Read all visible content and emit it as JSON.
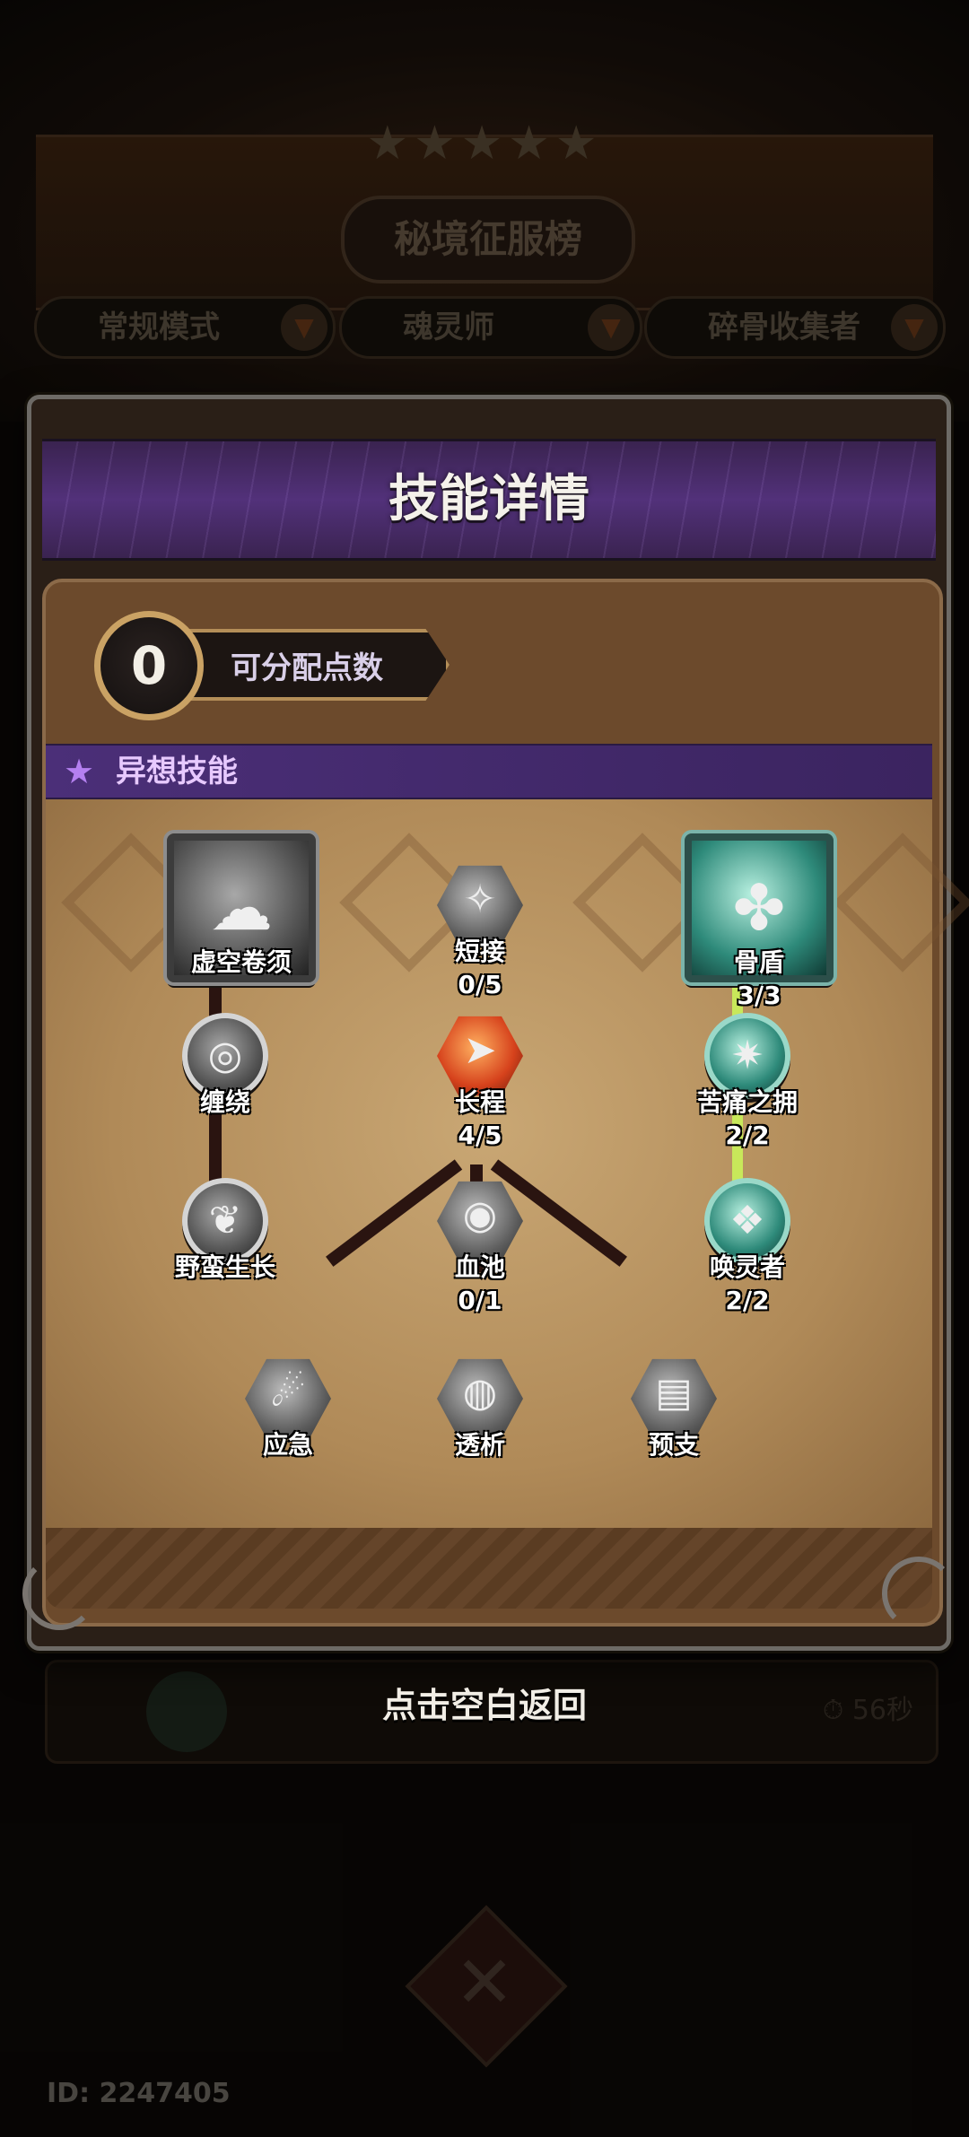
{
  "background": {
    "title": "秘境征服榜",
    "filters": [
      {
        "label": "常规模式"
      },
      {
        "label": "魂灵师"
      },
      {
        "label": "碎骨收集者"
      }
    ],
    "row_time": "56秒",
    "player_id": "ID: 2247405"
  },
  "modal": {
    "title": "技能详情",
    "points": {
      "value": "0",
      "label": "可分配点数"
    },
    "section": {
      "label": "异想技能"
    },
    "skills": {
      "void_tendril": {
        "name": "虚空卷须",
        "level": ""
      },
      "short_link": {
        "name": "短接",
        "level": "0/5"
      },
      "bone_shield": {
        "name": "骨盾",
        "level": "3/3"
      },
      "entangle": {
        "name": "缠绕",
        "level": ""
      },
      "long_range": {
        "name": "长程",
        "level": "4/5"
      },
      "pain_embrace": {
        "name": "苦痛之拥",
        "level": "2/2"
      },
      "wild_growth": {
        "name": "野蛮生长",
        "level": ""
      },
      "blood_pool": {
        "name": "血池",
        "level": "0/1"
      },
      "summoner": {
        "name": "唤灵者",
        "level": "2/2"
      },
      "emergency": {
        "name": "应急",
        "level": ""
      },
      "overdraw": {
        "name": "透析",
        "level": ""
      },
      "advance": {
        "name": "预支",
        "level": ""
      }
    }
  },
  "close_hint": "点击空白返回",
  "colors": {
    "accent_purple": "#52317a",
    "lit_link": "#c8e85a",
    "panel_brown": "#b08a58"
  }
}
